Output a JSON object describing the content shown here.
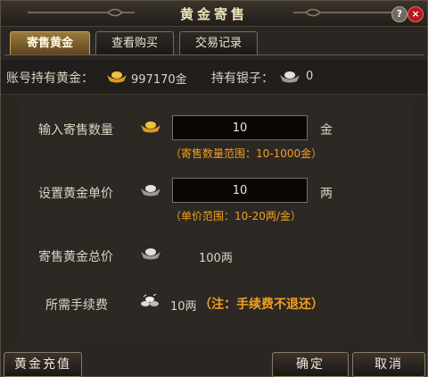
{
  "window": {
    "title": "黄金寄售"
  },
  "tabs": [
    {
      "label": "寄售黄金",
      "active": true
    },
    {
      "label": "查看购买",
      "active": false
    },
    {
      "label": "交易记录",
      "active": false
    }
  ],
  "account": {
    "gold_label": "账号持有黄金：",
    "gold_value": "997170金",
    "silver_label": "持有银子：",
    "silver_value": "0"
  },
  "form": {
    "quantity_label": "输入寄售数量",
    "quantity_value": "10",
    "quantity_unit": "金",
    "quantity_hint": "（寄售数量范围：10-1000金）",
    "price_label": "设置黄金单价",
    "price_value": "10",
    "price_unit": "两",
    "price_hint": "（单价范围：10-20两/金）",
    "total_label": "寄售黄金总价",
    "total_value": "100两",
    "fee_label": "所需手续费",
    "fee_value": "10两",
    "fee_note": "（注：手续费不退还）"
  },
  "buttons": {
    "recharge": "黄金充值",
    "confirm": "确定",
    "cancel": "取消"
  },
  "icons": {
    "help": "?",
    "close": "×"
  },
  "colors": {
    "accent_gold": "#c8a25a",
    "hint_orange": "#f2a020",
    "close_red": "#b81818"
  }
}
